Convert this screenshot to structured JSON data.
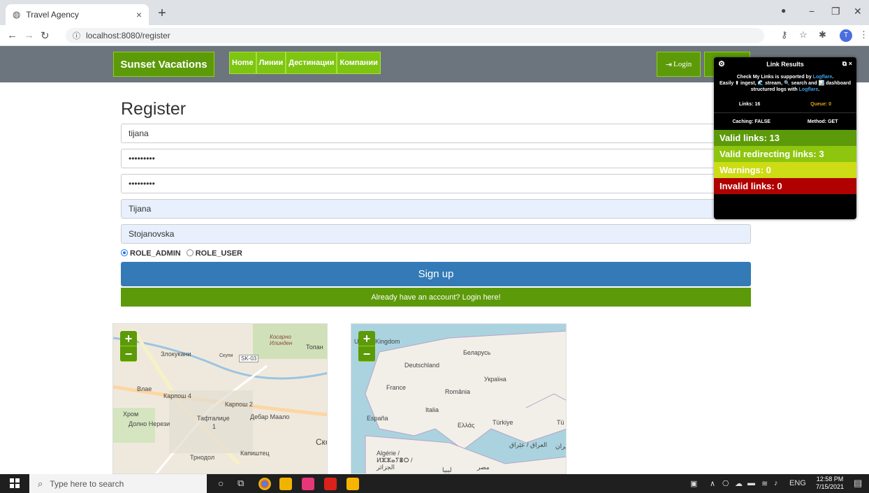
{
  "browser": {
    "tab_title": "Travel Agency",
    "tab_close": "×",
    "new_tab": "+",
    "url": "localhost:8080/register",
    "avatar_initial": "T"
  },
  "navbar": {
    "brand": "Sunset Vacations",
    "links": [
      "Home",
      "Линии",
      "Дестинации",
      "Компании"
    ],
    "login": "Login"
  },
  "form": {
    "heading": "Register",
    "username": "tijana",
    "password": "•••••••••",
    "repeat_password": "•••••••••",
    "name": "Tijana",
    "surname": "Stojanovska",
    "roles": [
      "ROLE_ADMIN",
      "ROLE_USER"
    ],
    "selected_role": "ROLE_ADMIN",
    "signup_label": "Sign up",
    "login_link": "Already have an account? Login here!"
  },
  "maps": {
    "zoom_in": "+",
    "zoom_out": "−",
    "skopje_labels": [
      "Злокукани",
      "Влае",
      "Карпош 4",
      "Карпош 2",
      "Хром",
      "Тафталиџе",
      "Дебар Маало",
      "Долно Нерези",
      "Трнодол",
      "Капиштец",
      "Косарно Илинден",
      "Топан",
      "SK-03",
      "Скупи",
      "Ско",
      "1"
    ],
    "europe_labels": [
      "Kingdom",
      "Беларусь",
      "Deutschland",
      "Україна",
      "France",
      "România",
      "Italia",
      "España",
      "Ελλάς",
      "Türkiye",
      "Algérie / ⵍⵣⵣⴰⵢⴻⵔ / الجزائر",
      "العراق / عێراق",
      "ليبيا",
      "مصر",
      "ایران",
      "Tü",
      "U"
    ]
  },
  "link_results": {
    "title": "Link Results",
    "desc_line1": "Check My Links is supported by",
    "desc_brand": "Logflare",
    "desc_line2": "Easily ⬆ ingest, 🌊 stream, 🔍 search and 📊 dashboard structured logs with",
    "links": "Links: 16",
    "queue": "Queue: 0",
    "caching": "Caching: FALSE",
    "method": "Method: GET",
    "valid": "Valid links: 13",
    "redirecting": "Valid redirecting links: 3",
    "warnings": "Warnings: 0",
    "invalid": "Invalid links: 0"
  },
  "taskbar": {
    "search_placeholder": "Type here to search",
    "lang": "ENG",
    "time": "12:58 PM",
    "date": "7/15/2021"
  },
  "colors": {
    "green_dark": "#5c9a09",
    "green_light": "#7ec512",
    "blue_button": "#337ab7",
    "navbar_gray": "#6c757d"
  }
}
